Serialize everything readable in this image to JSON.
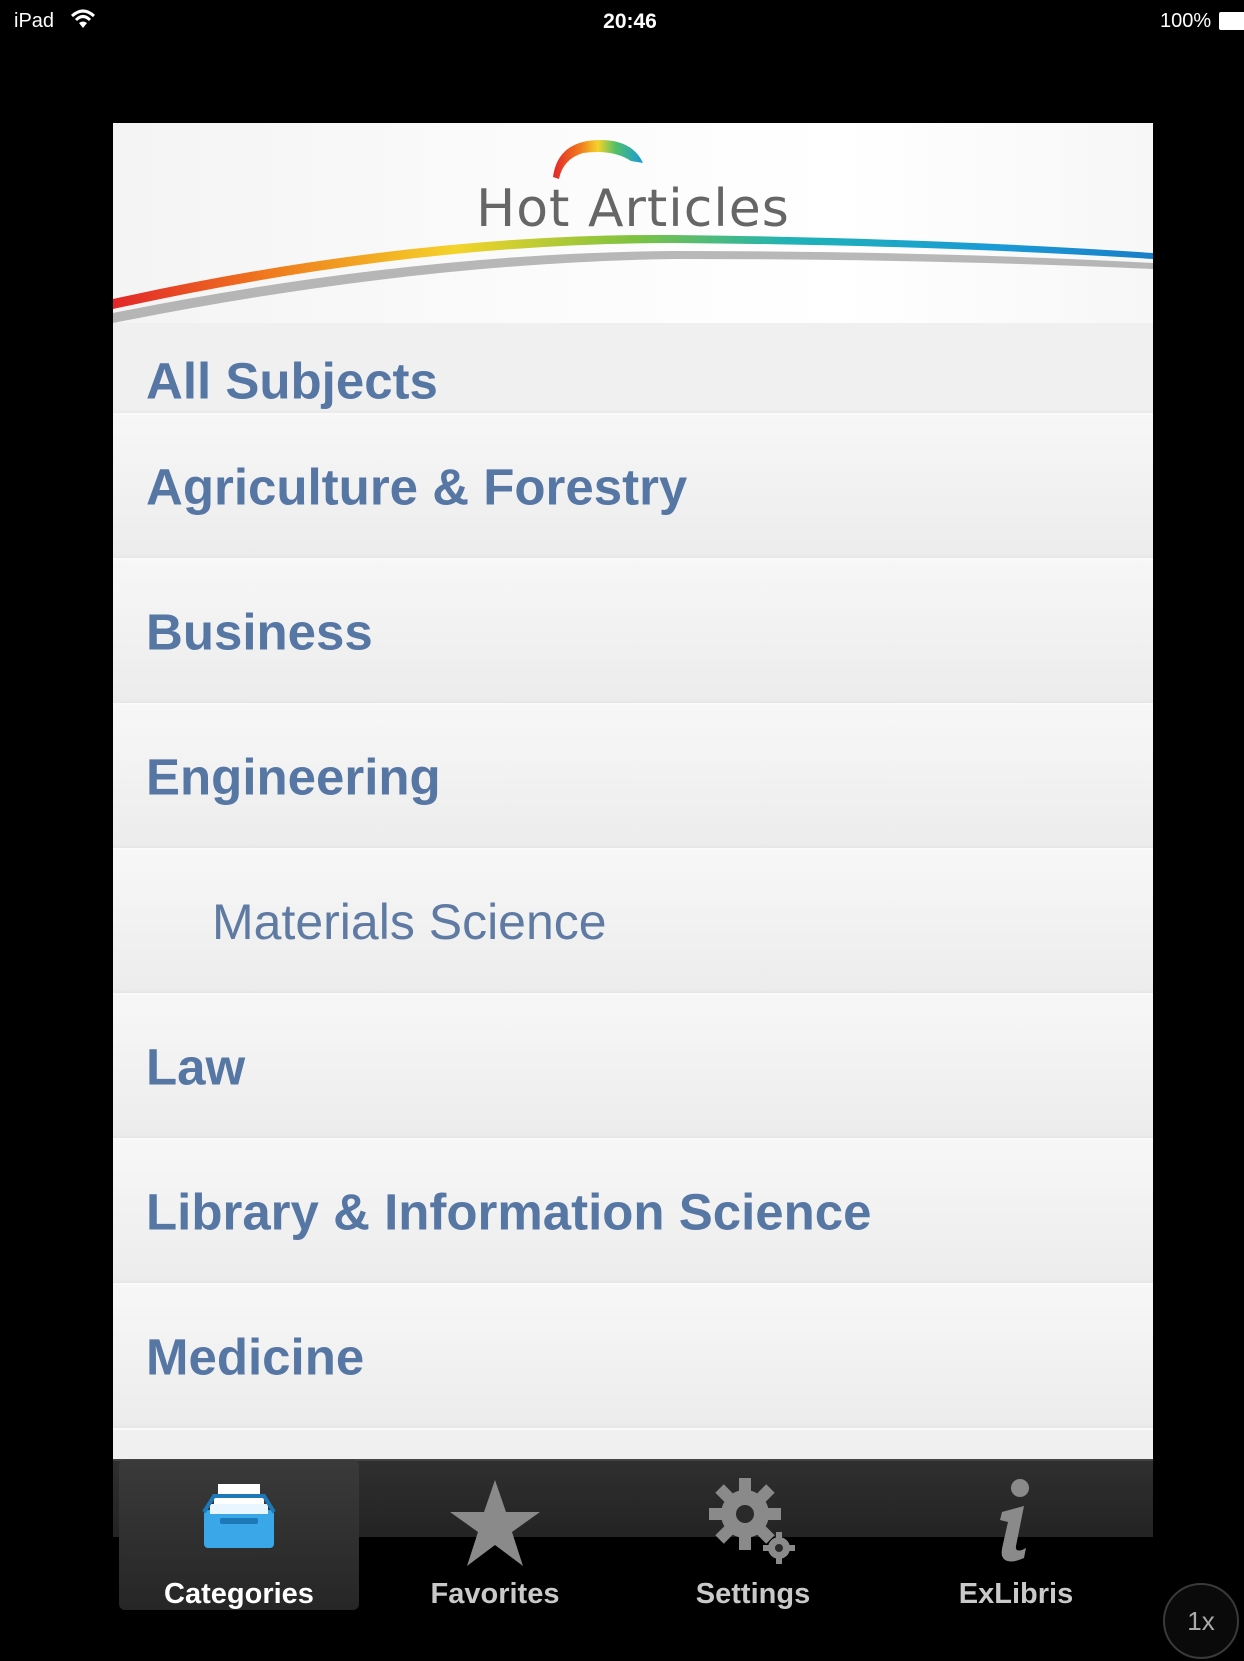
{
  "status_bar": {
    "device": "iPad",
    "time": "20:46",
    "battery": "100%",
    "wifi_icon": "wifi-icon",
    "battery_icon": "battery-icon"
  },
  "header": {
    "title": "Hot Articles"
  },
  "categories": [
    {
      "label": "All Subjects",
      "level": 0
    },
    {
      "label": "Agriculture & Forestry",
      "level": 0
    },
    {
      "label": "Business",
      "level": 0
    },
    {
      "label": "Engineering",
      "level": 0
    },
    {
      "label": "Materials Science",
      "level": 1
    },
    {
      "label": "Law",
      "level": 0
    },
    {
      "label": "Library & Information Science",
      "level": 0
    },
    {
      "label": "Medicine",
      "level": 0
    }
  ],
  "tabs": [
    {
      "label": "Categories",
      "icon": "tray-icon",
      "active": true
    },
    {
      "label": "Favorites",
      "icon": "star-icon",
      "active": false
    },
    {
      "label": "Settings",
      "icon": "gear-icon",
      "active": false
    },
    {
      "label": "ExLibris",
      "icon": "info-icon",
      "active": false
    }
  ],
  "zoom_button": {
    "label": "1x"
  },
  "colors": {
    "category_text": "#5676a4",
    "tabbar_bg": "#2a2a2a",
    "tray_blue": "#3aa8e8",
    "title_gray": "#666666"
  }
}
